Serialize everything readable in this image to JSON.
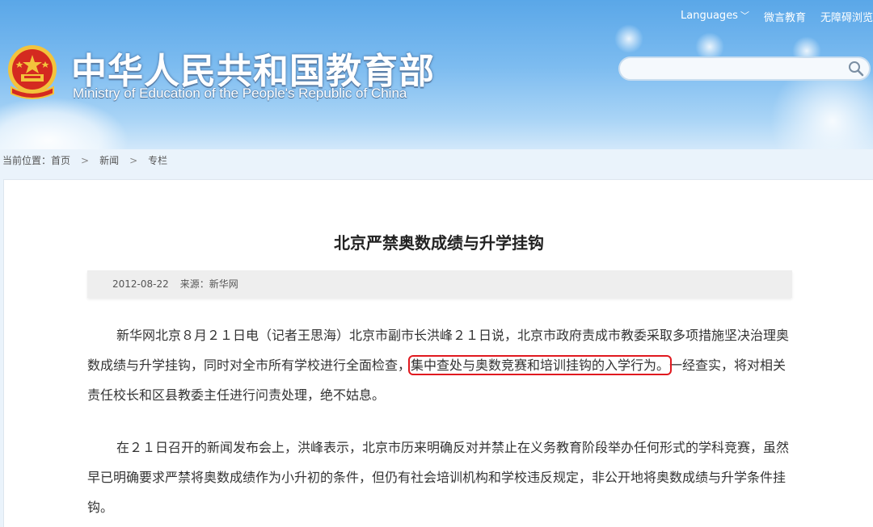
{
  "header": {
    "title_cn": "中华人民共和国教育部",
    "title_en": "Ministry of Education of the People's Republic of China",
    "links": {
      "languages": "Languages",
      "weibo": "微言教育",
      "accessibility": "无障碍浏览"
    },
    "search": {
      "placeholder": ""
    }
  },
  "breadcrumb": {
    "prefix": "当前位置：",
    "items": [
      "首页",
      "新闻",
      "专栏"
    ]
  },
  "article": {
    "title": "北京严禁奥数成绩与升学挂钩",
    "date": "2012-08-22",
    "source": "来源：新华网",
    "paragraph1": {
      "before": "新华网北京８月２１日电（记者王思海）北京市副市长洪峰２１日说，北京市政府责成市教委采取多项措施坚决治理奥数成绩与升学挂钩，同时对全市所有学校进行全面检查，",
      "highlight": "集中查处与奥数竞赛和培训挂钩的入学行为。",
      "after": "一经查实，将对相关责任校长和区县教委主任进行问责处理，绝不姑息。"
    },
    "paragraph2": "在２１日召开的新闻发布会上，洪峰表示，北京市历来明确反对并禁止在义务教育阶段举办任何形式的学科竞赛，虽然早已明确要求严禁将奥数成绩作为小升初的条件，但仍有社会培训机构和学校违反规定，非公开地将奥数成绩与升学条件挂钩。"
  },
  "colors": {
    "header_blue": "#5aa7e8",
    "highlight_red": "#e0191f",
    "emblem_red": "#d42a20",
    "emblem_gold": "#f3c33c"
  }
}
